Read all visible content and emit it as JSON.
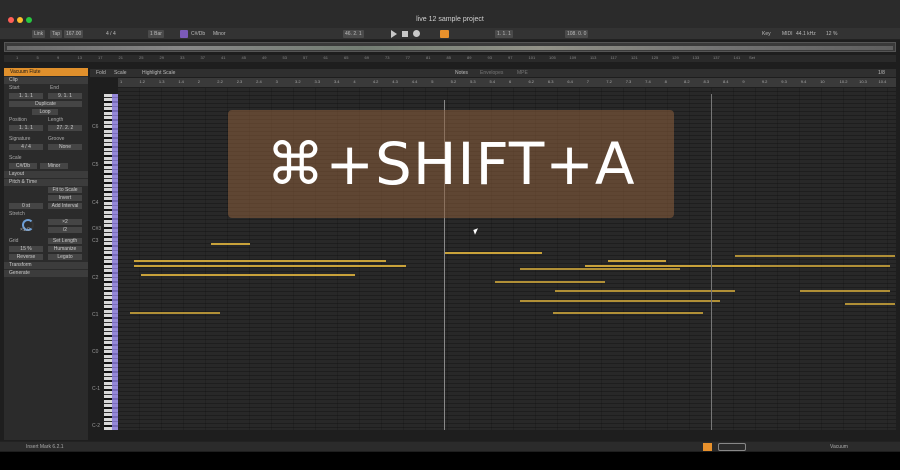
{
  "window": {
    "title": "live 12 sample project"
  },
  "controlbar": {
    "link": "Link",
    "tap": "Tap",
    "tempo": "167.00",
    "signature": "4 / 4",
    "quantize": "1 Bar",
    "scale_root": "C#/Db",
    "scale_mode": "Minor",
    "position": "46.  2.  1",
    "loop_start": "1.  1.  1",
    "loop_length": "108.  0.  0",
    "key": "Key",
    "midi": "MIDI",
    "sample_rate": "44.1 kHz",
    "cpu": "12 %",
    "accent": "#e8912c"
  },
  "ruler_bars": [
    "1",
    "5",
    "9",
    "13",
    "17",
    "21",
    "25",
    "29",
    "33",
    "37",
    "41",
    "45",
    "49",
    "53",
    "57",
    "61",
    "65",
    "69",
    "73",
    "77",
    "81",
    "85",
    "89",
    "93",
    "97",
    "101",
    "105",
    "109",
    "113",
    "117",
    "121",
    "125",
    "129",
    "133",
    "137",
    "141"
  ],
  "ruler_set": "Set",
  "clip_panel": {
    "track_name": "Vacuum Flute",
    "clip_section": "Clip",
    "start_label": "Start",
    "end_label": "End",
    "start_value": "1.  1.  1",
    "end_value": "9.  1.  1",
    "duplicate": "Duplicate",
    "loop": "Loop",
    "position_label": "Position",
    "length_label": "Length",
    "position_value": "1.  1.  1",
    "length_value": "27.  2.  2",
    "signature_label": "Signature",
    "groove_label": "Groove",
    "signature_value": "4  /  4",
    "groove_value": "None",
    "scale_label": "Scale",
    "scale_root": "C#/Db",
    "scale_mode": "Minor",
    "layout_section": "Layout",
    "pitch_time_section": "Pitch & Time",
    "fit_to_scale": "Fit to Scale",
    "invert": "Invert",
    "add_interval": "Add Interval",
    "interval_value": "0 st",
    "stretch_label": "Stretch",
    "stretch_value": "×1.0",
    "double": "×2",
    "half": "/2",
    "grid_label": "Grid",
    "set_length": "Set Length",
    "humanize": "Humanize",
    "humanize_value": "15 %",
    "reverse": "Reverse",
    "legato": "Legato",
    "transform_section": "Transform",
    "generate_section": "Generate"
  },
  "editor": {
    "tabs": [
      "Fold",
      "Scale",
      "Highlight Scale"
    ],
    "view_tabs": [
      "Notes",
      "Envelopes",
      "MPE"
    ],
    "grid_division": "1/8",
    "ruler": [
      "1",
      "1.2",
      "1.3",
      "1.4",
      "2",
      "2.2",
      "2.3",
      "2.4",
      "3",
      "3.2",
      "3.3",
      "3.4",
      "4",
      "4.2",
      "4.3",
      "4.4",
      "5",
      "5.2",
      "5.3",
      "5.4",
      "6",
      "6.2",
      "6.3",
      "6.4",
      "7",
      "7.2",
      "7.3",
      "7.4",
      "8",
      "8.2",
      "8.3",
      "8.4",
      "9",
      "9.2",
      "9.3",
      "9.4",
      "10",
      "10.2",
      "10.3",
      "10.4"
    ],
    "octaves": [
      "C6",
      "C5",
      "C4",
      "C#3",
      "C3",
      "C2",
      "C1",
      "C0",
      "C-1",
      "C-2"
    ],
    "note_color": "#c9a23a",
    "notes": [
      {
        "bar": 2.2,
        "length": 0.5,
        "pitch_row": 0
      },
      {
        "bar": 5.2,
        "length": 1.25,
        "pitch_row": 1
      },
      {
        "bar": 1.2,
        "length": 3.25,
        "pitch_row": 2
      },
      {
        "bar": 1.2,
        "length": 3.5,
        "pitch_row": 3
      },
      {
        "bar": 1.3,
        "length": 2.75,
        "pitch_row": 4
      },
      {
        "bar": 7.3,
        "length": 0.75,
        "pitch_row": 2
      },
      {
        "bar": 7.0,
        "length": 2.25,
        "pitch_row": 3
      }
    ]
  },
  "overlay": {
    "shortcut": "⌘+SHIFT+A"
  },
  "statusbar": {
    "left": "Insert Mark 6.2.1",
    "right": "Vacuum"
  }
}
